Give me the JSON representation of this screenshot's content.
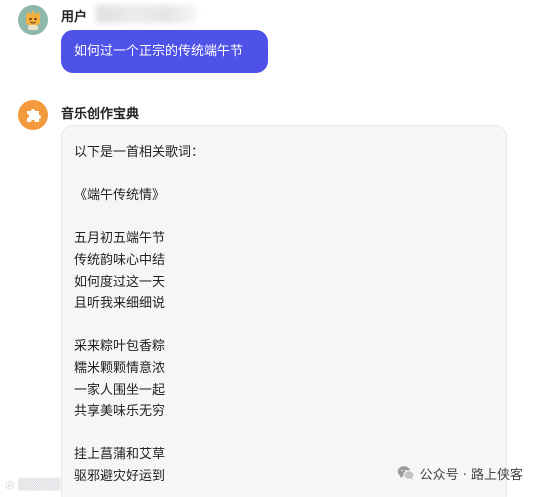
{
  "user": {
    "name": "用户",
    "message": "如何过一个正宗的传统端午节"
  },
  "bot": {
    "name": "音乐创作宝典",
    "lines": [
      "以下是一首相关歌词：",
      "",
      "《端午传统情》",
      "",
      "五月初五端午节",
      "传统韵味心中结",
      "如何度过这一天",
      "且听我来细细说",
      "",
      "采来粽叶包香粽",
      "糯米颗颗情意浓",
      "一家人围坐一起",
      "共享美味乐无穷",
      "",
      "挂上菖蒲和艾草",
      "驱邪避灾好运到"
    ]
  },
  "watermark": {
    "icon": "wechat-icon",
    "text": "公众号 · 路上侠客"
  },
  "colors": {
    "user_bubble": "#4e52e6",
    "user_avatar": "#8fb8ad",
    "bot_avatar": "#f39a3d",
    "bot_bubble": "#f5f6f8"
  }
}
